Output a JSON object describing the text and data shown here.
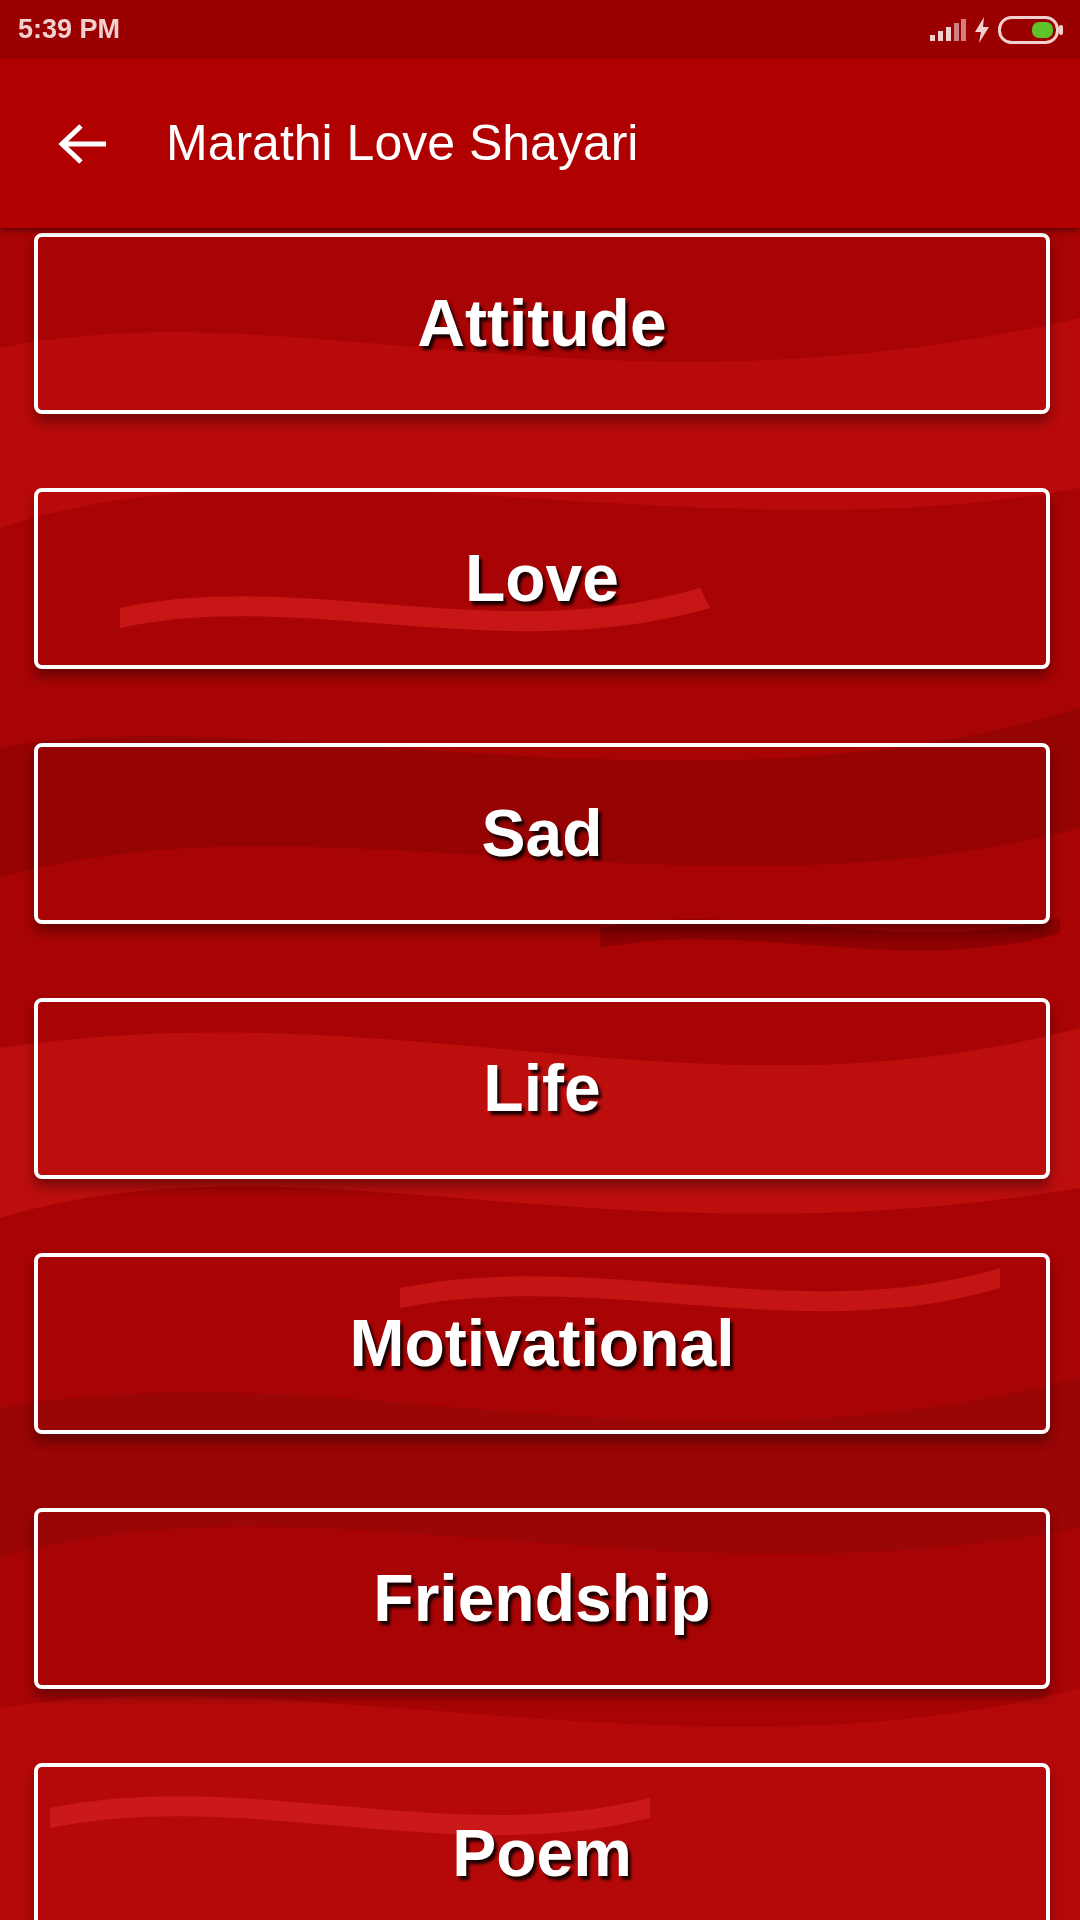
{
  "status_bar": {
    "time": "5:39 PM"
  },
  "app_bar": {
    "title": "Marathi Love Shayari"
  },
  "categories": [
    {
      "label": "Attitude"
    },
    {
      "label": "Love"
    },
    {
      "label": "Sad"
    },
    {
      "label": "Life"
    },
    {
      "label": "Motivational"
    },
    {
      "label": "Friendship"
    },
    {
      "label": "Poem"
    }
  ]
}
